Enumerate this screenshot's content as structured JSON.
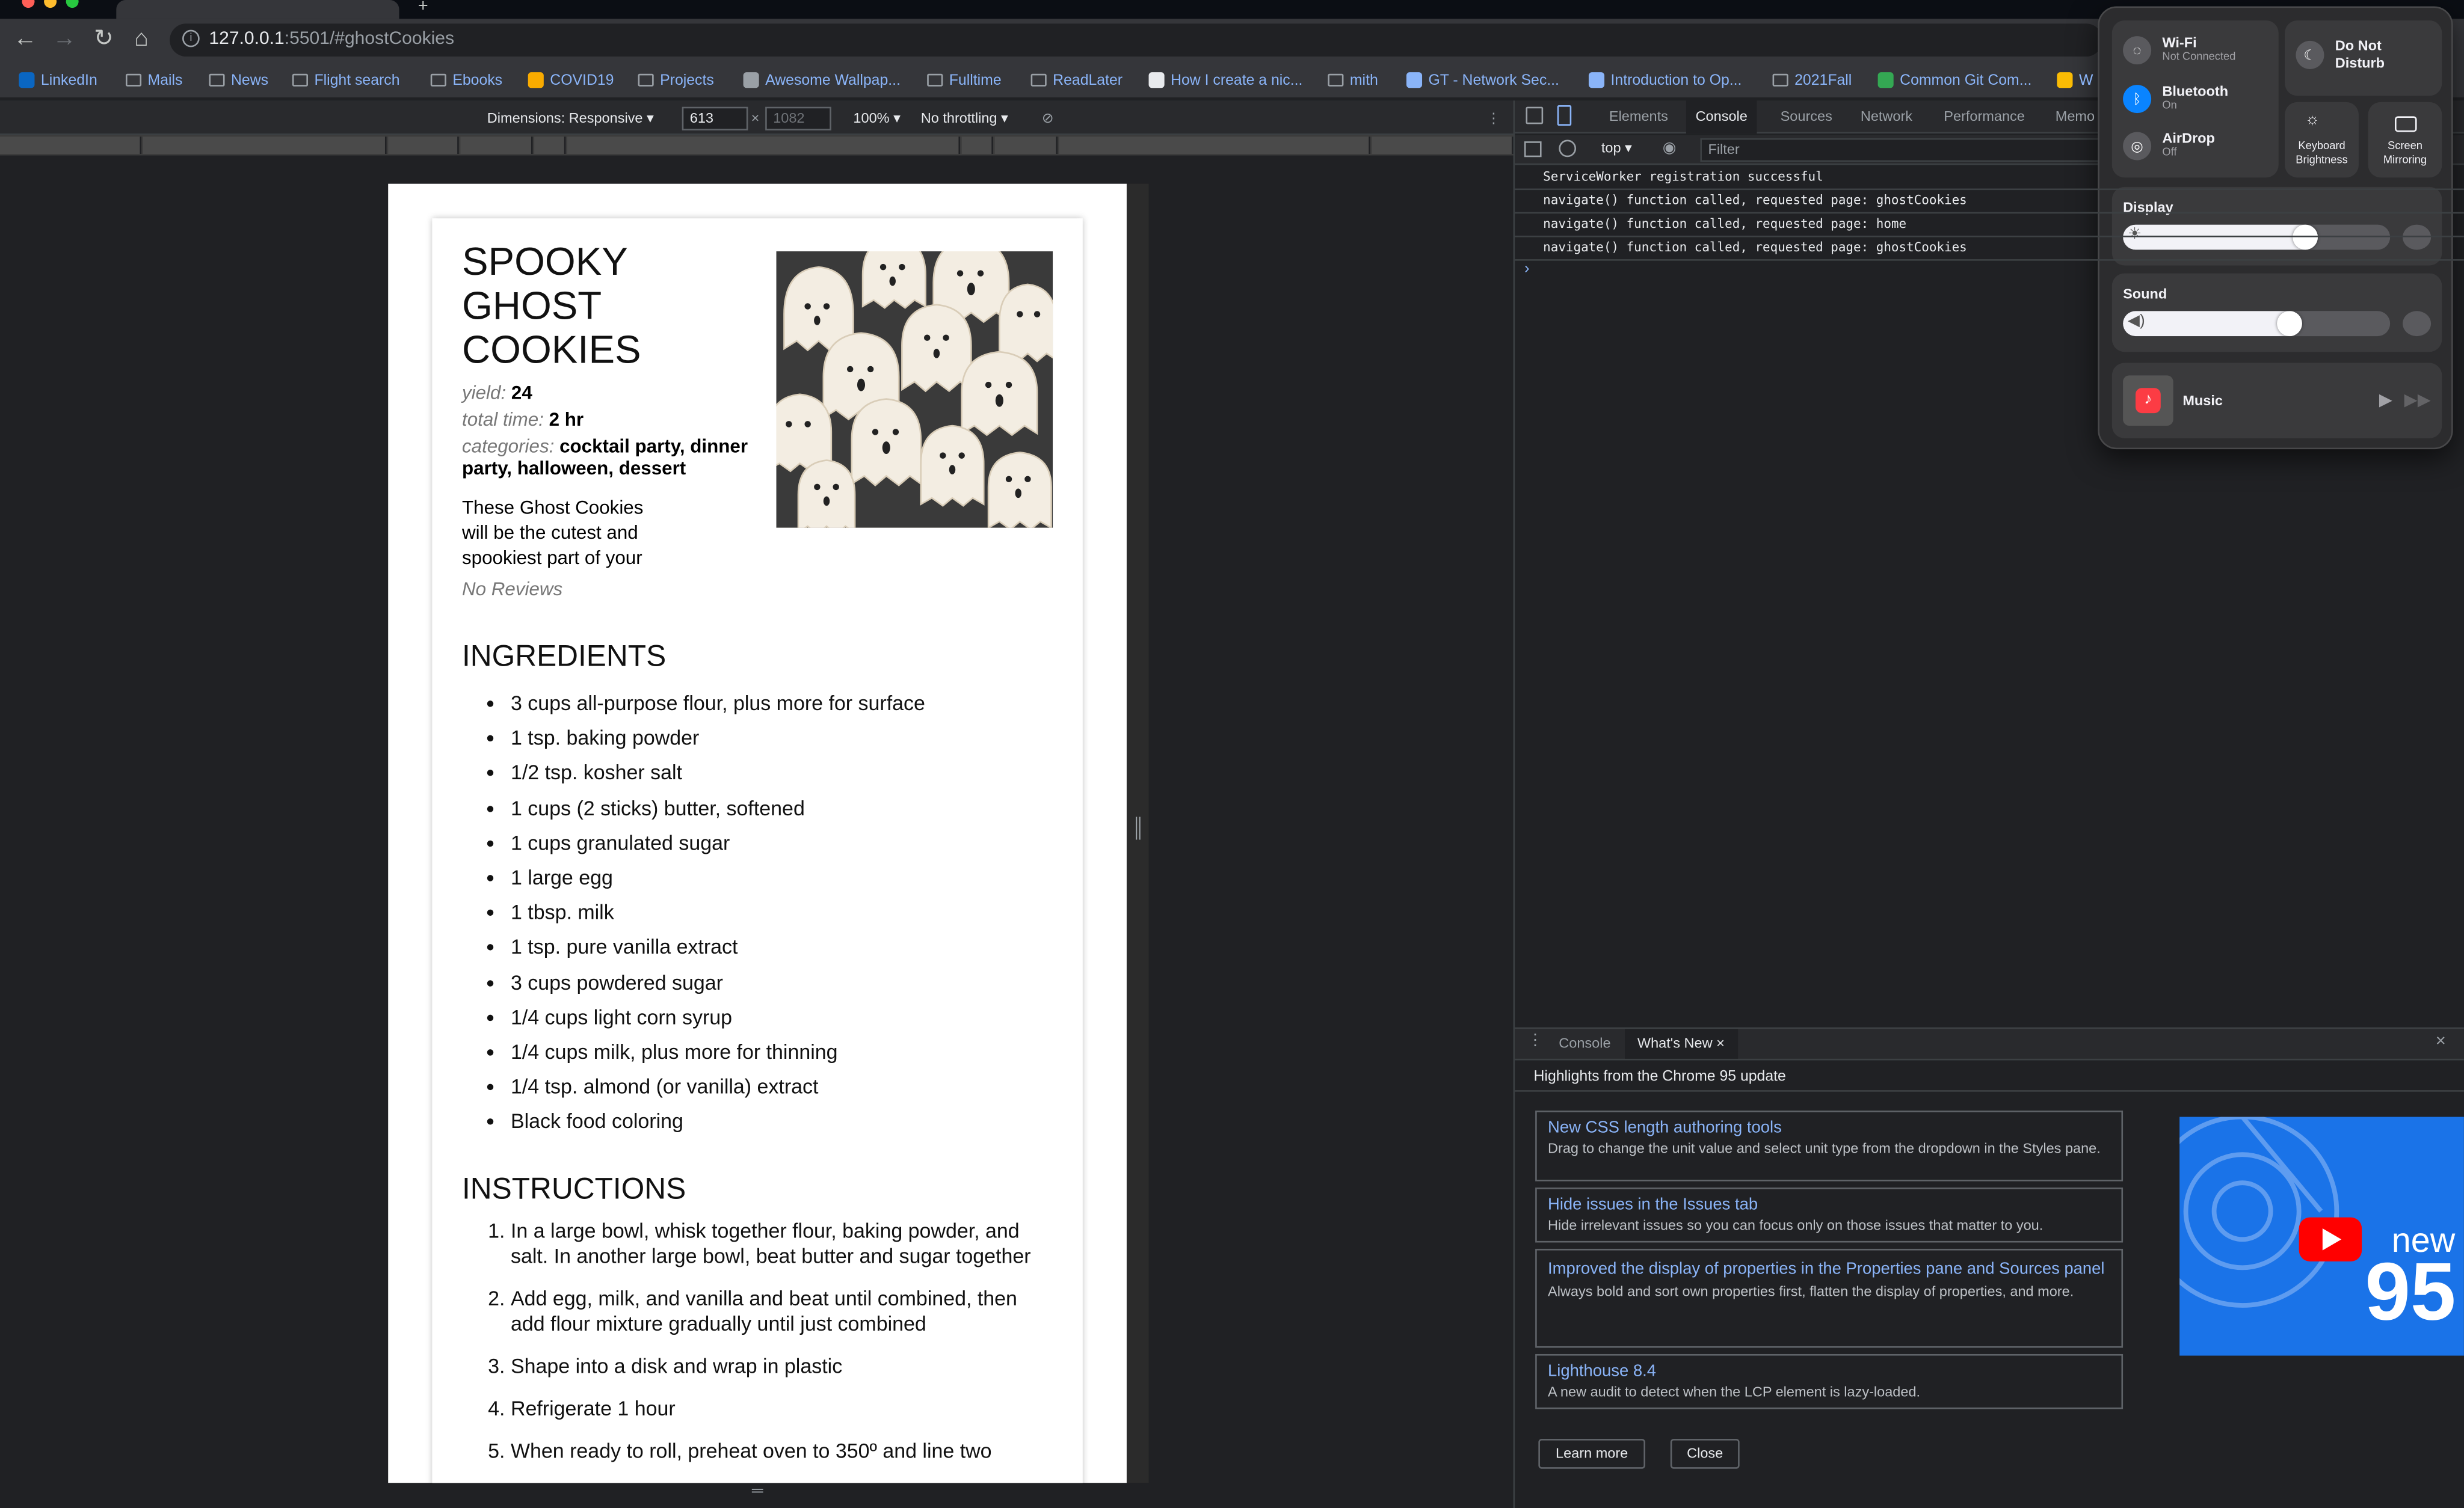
{
  "browser": {
    "url_host": "127.0.0.1",
    "url_rest": ":5501/#ghostCookies",
    "bookmarks": [
      {
        "label": "LinkedIn",
        "icon": "linkedin-icon"
      },
      {
        "label": "Mails",
        "icon": "folder-icon"
      },
      {
        "label": "News",
        "icon": "folder-icon"
      },
      {
        "label": "Flight search",
        "icon": "folder-icon"
      },
      {
        "label": "Ebooks",
        "icon": "folder-icon"
      },
      {
        "label": "COVID19",
        "icon": "covid-icon"
      },
      {
        "label": "Projects",
        "icon": "folder-icon"
      },
      {
        "label": "Awesome Wallpap...",
        "icon": "wallpaper-icon"
      },
      {
        "label": "Fulltime",
        "icon": "folder-icon"
      },
      {
        "label": "ReadLater",
        "icon": "folder-icon"
      },
      {
        "label": "How I create a nic...",
        "icon": "globe-icon"
      },
      {
        "label": "mith",
        "icon": "folder-icon"
      },
      {
        "label": "GT - Network Sec...",
        "icon": "gt-icon"
      },
      {
        "label": "Introduction to Op...",
        "icon": "gt-icon"
      },
      {
        "label": "2021Fall",
        "icon": "folder-icon"
      },
      {
        "label": "Common Git Com...",
        "icon": "doc-icon"
      },
      {
        "label": "W",
        "icon": "drive-icon"
      }
    ]
  },
  "device_toolbar": {
    "dimensions_label": "Dimensions: Responsive",
    "width": "613",
    "height": "1082",
    "times": "×",
    "zoom": "100%",
    "throttling": "No throttling"
  },
  "recipe": {
    "title": "SPOOKY GHOST COOKIES",
    "yield_label": "yield:",
    "yield_value": "24",
    "time_label": "total time:",
    "time_value": "2 hr",
    "categories_label": "categories:",
    "categories_value": "cocktail party, dinner party, halloween, dessert",
    "description": "These Ghost Cookies will be the cutest and spookiest part of your",
    "reviews": "No Reviews",
    "ingredients_heading": "INGREDIENTS",
    "ingredients": [
      "3 cups all-purpose flour, plus more for surface",
      "1 tsp. baking powder",
      "1/2 tsp. kosher salt",
      "1 cups (2 sticks) butter, softened",
      "1 cups granulated sugar",
      "1 large egg",
      "1 tbsp. milk",
      "1 tsp. pure vanilla extract",
      "3 cups powdered sugar",
      "1/4 cups light corn syrup",
      "1/4 cups milk, plus more for thinning",
      "1/4 tsp. almond (or vanilla) extract",
      "Black food coloring"
    ],
    "instructions_heading": "INSTRUCTIONS",
    "instructions": [
      "In a large bowl, whisk together flour, baking powder, and salt.  In another large bowl, beat butter and sugar together",
      "Add egg, milk, and vanilla and beat until combined, then add flour mixture gradually until just combined",
      "Shape into a disk and wrap in plastic",
      "Refrigerate 1 hour",
      "When ready to roll, preheat oven to 350º and line two"
    ]
  },
  "devtools": {
    "tabs": [
      "Elements",
      "Console",
      "Sources",
      "Network",
      "Performance",
      "Memo"
    ],
    "active_tab": "Console",
    "context": "top",
    "filter_placeholder": "Filter",
    "console_logs": [
      "ServiceWorker registration successful",
      "navigate() function called, requested page: ghostCookies",
      "navigate() function called, requested page: home",
      "navigate() function called, requested page: ghostCookies"
    ],
    "prompt": "›",
    "drawer": {
      "tabs": [
        "Console",
        "What's New"
      ],
      "active_tab": "What's New",
      "subtitle": "Highlights from the Chrome 95 update",
      "cards": [
        {
          "title": "New CSS length authoring tools",
          "desc": "Drag to change the unit value and select unit type from the dropdown in the Styles pane."
        },
        {
          "title": "Hide issues in the Issues tab",
          "desc": "Hide irrelevant issues so you can focus only on those issues that matter to you."
        },
        {
          "title": "Improved the display of properties in the Properties pane and Sources panel",
          "desc": "Always bold and sort own properties first, flatten the display of properties, and more."
        },
        {
          "title": "Lighthouse 8.4",
          "desc": "A new audit to detect when the LCP element is lazy-loaded."
        }
      ],
      "video_text_new": "new",
      "video_text_95": "95",
      "learn_more": "Learn more",
      "close": "Close"
    }
  },
  "control_center": {
    "wifi_label": "Wi-Fi",
    "wifi_status": "Not Connected",
    "bluetooth_label": "Bluetooth",
    "bluetooth_status": "On",
    "airdrop_label": "AirDrop",
    "airdrop_status": "Off",
    "dnd_label": "Do Not Disturb",
    "keyboard_label": "Keyboard Brightness",
    "mirroring_label": "Screen Mirroring",
    "display_label": "Display",
    "display_level": 0.73,
    "sound_label": "Sound",
    "sound_level": 0.67,
    "music_label": "Music"
  },
  "colors": {
    "accent": "#8ab4f8",
    "bluetooth": "#0a84ff",
    "video_bg": "#1a73e8",
    "youtube_red": "#ff0000"
  }
}
